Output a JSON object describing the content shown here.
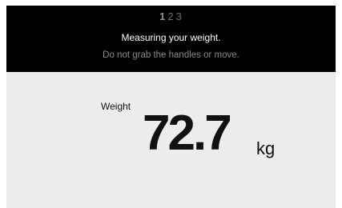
{
  "header": {
    "steps": [
      "1",
      "2",
      "3"
    ],
    "active_step": "1",
    "message": "Measuring your weight.",
    "instruction": "Do not grab the handles or move."
  },
  "reading": {
    "label": "Weight",
    "value": "72.7",
    "unit": "kg"
  },
  "colors": {
    "header_bg": "#000000",
    "body_bg": "#ececec",
    "text_primary": "#111111",
    "text_secondary": "#8a8a8a"
  }
}
